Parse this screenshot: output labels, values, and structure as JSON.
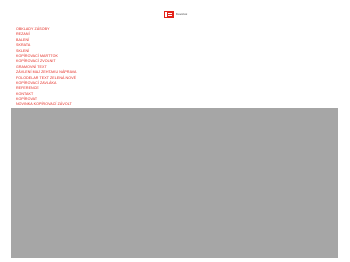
{
  "header": {
    "logo_text": "Kovolux"
  },
  "nav": {
    "items": [
      "OBKLADY ZÁSOBY",
      "REZANÍ",
      "BALENÍ",
      "SKRATA",
      "SKLENÍ",
      "KOPÍROVACÍ MARTTOK",
      "KOPÍROVACÍ ZVOLNIT",
      "GRAMOVNÍ TEXT",
      "ZÁVLENÍ MAJ ZEHTAKU NÁPRAVA",
      "FOLODELAR TEXT ZELENÁ NOVÉ",
      "KOPÍROVACÍ ZAVLÁKA",
      "REFERENCE",
      "KONTAKT",
      "KOPÍROVAT",
      "NOVINKA KOPÍROVACÍ ZÁVOLT"
    ]
  },
  "colors": {
    "accent": "#e2231a",
    "overlay": "#a6a6a6"
  }
}
